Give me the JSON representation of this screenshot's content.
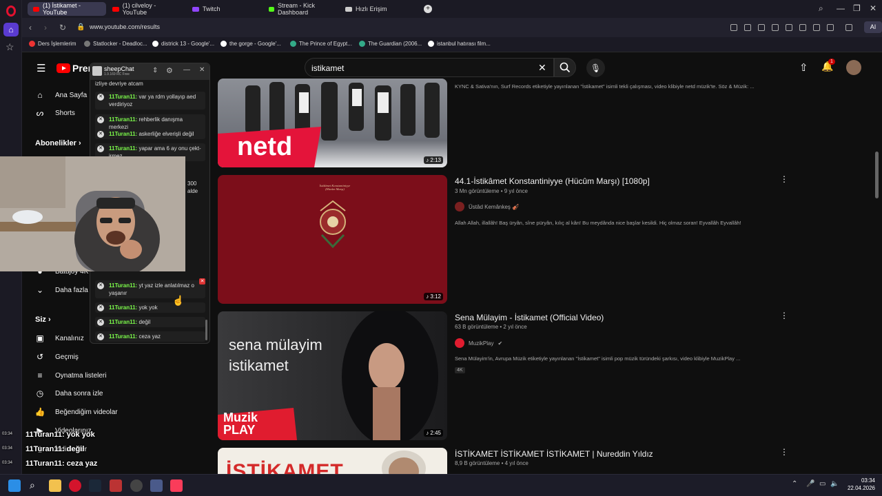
{
  "browser": {
    "tabs": [
      {
        "label": "(1) İstikamet - YouTube",
        "icon": "youtube-icon"
      },
      {
        "label": "(1) cilveloy - YouTube",
        "icon": "youtube-icon"
      },
      {
        "label": "Twitch",
        "icon": "twitch-icon"
      },
      {
        "label": "Stream - Kick Dashboard",
        "icon": "kick-icon"
      },
      {
        "label": "Hızlı Erişim",
        "icon": "grid-icon"
      }
    ],
    "url": "www.youtube.com/results",
    "ai_label": "AI",
    "bookmarks": [
      "Ders İşlemlerim",
      "Statlocker - Deadloc...",
      "districk 13 - Google'...",
      "the gorge - Google'...",
      "The Prince of Egypt...",
      "The Guardian (2006...",
      "istanbul hatırası film..."
    ]
  },
  "youtube": {
    "logo_text": "Prem",
    "search_query": "istikamet",
    "notification_count": "1",
    "sidebar": {
      "home": "Ana Sayfa",
      "shorts": "Shorts",
      "subscriptions_header": "Abonelikler",
      "sub_item": "Batujoy 4K",
      "more": "Daha fazla",
      "you_header": "Siz",
      "channel": "Kanalınız",
      "history": "Geçmiş",
      "playlists": "Oynatma listeleri",
      "watch_later": "Daha sonra izle",
      "liked": "Beğendiğim videolar",
      "your_videos": "Videolarınız",
      "downloads": "İndirilenler"
    },
    "results": [
      {
        "title": "",
        "views": "",
        "age": "",
        "channel": "",
        "desc": "KYNC & Sativa'nın, Surf Records etiketiyle yayınlanan \"İstikamet\" isimli tekli çalışması, video klibiyle netd müzik'te. Söz & Müzik: ...",
        "duration": "2:13",
        "thumb_text": "netd"
      },
      {
        "title": "44.1-İstikâmet Konstantiniyye (Hücûm Marşı) [1080p]",
        "views": "3 Mn görüntüleme",
        "age": "9 yıl önce",
        "channel": "Üstâd Kemânkeş 🎻",
        "desc": "Allah Allah, illallâh! Baş üryân, sîne püryân, kılıç al kân! Bu meydânda nice başlar kesildi. Hiç olmaz soran! Eyvallâh Eyvallâh!",
        "duration": "3:12",
        "thumb_text": "İstikâmet Konstantiniyye (Hücûm Marşı)"
      },
      {
        "title": "Sena Mülayim - İstikamet (Official Video)",
        "views": "63 B görüntüleme",
        "age": "2 yıl önce",
        "channel": "MuzikPlay",
        "desc": "Sena Mülayim'in, Avrupa Müzik etiketiyle yayınlanan \"İstikamet\" isimli pop müzik türündeki şarkısı, video klibiyle MuzikPlay ...",
        "badge": "4K",
        "duration": "2:45",
        "thumb_text": "sena mülayim istikamet",
        "thumb_brand": "Muzik PLAY"
      },
      {
        "title": "İSTİKAMET İSTİKAMET İSTİKAMET | Nureddin Yıldız",
        "views": "8,9 B görüntüleme",
        "age": "4 yıl önce",
        "thumb_text": "İSTİKAMET"
      }
    ]
  },
  "sheepchat": {
    "title": "sheepChat",
    "version": "1.9.169 RC Free",
    "messages": [
      {
        "user": "",
        "text": "izliye devriye atcam"
      },
      {
        "user": "11Turan11:",
        "text": "var ya rdm yollayıp aed verdiriyoz"
      },
      {
        "user": "11Turan11:",
        "text": "rehberlik danışma merkezi"
      },
      {
        "user": "11Turan11:",
        "text": "askerliğe elverişli değil"
      },
      {
        "user": "11Turan11:",
        "text": "yapar ama 6 ay onu çekt-irmez"
      },
      {
        "user": "11Turan11:",
        "text": "yt yaz izle anlatılmaz o yaşanır"
      },
      {
        "user": "11Turan11:",
        "text": "yok yok"
      },
      {
        "user": "11Turan11:",
        "text": "değil"
      },
      {
        "user": "11Turan11:",
        "text": "ceza yaz"
      }
    ],
    "partial_right": [
      "300",
      "alde"
    ]
  },
  "overlay_chat": [
    {
      "time": "03:34",
      "user": "11Turan11",
      "text": ": yok yok"
    },
    {
      "time": "03:34",
      "user": "11Turan11",
      "text": ": değil"
    },
    {
      "time": "03:34",
      "user": "11Turan11",
      "text": ": ceza yaz"
    }
  ],
  "taskbar": {
    "time": "03:34",
    "date": "22.04.2026"
  },
  "colors": {
    "accent": "#ff0000",
    "chat_user": "#7cfc4a",
    "opera": "#e3112f"
  }
}
